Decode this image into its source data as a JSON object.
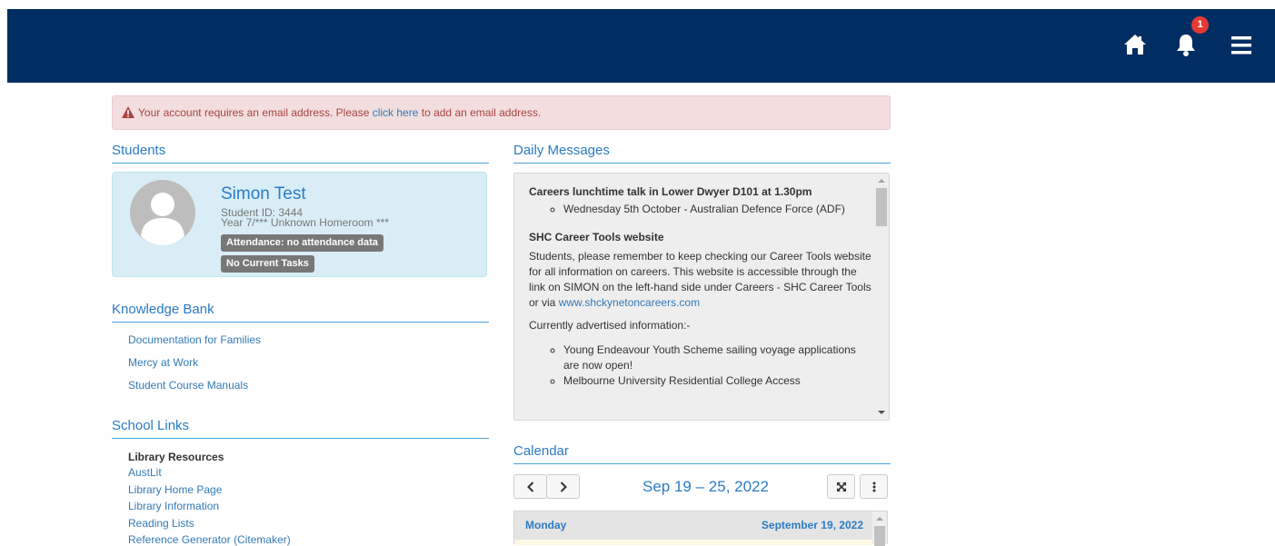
{
  "header": {
    "notification_count": "1",
    "colors": {
      "bar": "#002d62",
      "badge": "#e53935"
    },
    "icons": [
      "home-icon",
      "bell-icon",
      "menu-icon"
    ]
  },
  "alert": {
    "text_before": "Your account requires an email address. Please ",
    "link": "click here",
    "text_after": " to add an email address."
  },
  "students": {
    "title": "Students",
    "name": "Simon Test",
    "student_id": "Student ID: 3444",
    "homeroom": "Year 7/*** Unknown Homeroom ***",
    "attendance": "Attendance: no attendance data",
    "tasks": "No Current Tasks"
  },
  "knowledge_bank": {
    "title": "Knowledge Bank",
    "links": [
      "Documentation for Families",
      "Mercy at Work",
      "Student Course Manuals"
    ]
  },
  "school_links": {
    "title": "School Links",
    "group": "Library Resources",
    "links": [
      "AustLit",
      "Library Home Page",
      "Library Information",
      "Reading Lists",
      "Reference Generator (Citemaker)"
    ]
  },
  "daily_messages": {
    "title": "Daily Messages",
    "item1_title": "Careers lunchtime talk in Lower Dwyer D101 at 1.30pm",
    "item1_bullet": "Wednesday 5th October - Australian Defence Force (ADF)",
    "item2_title": "SHC Career Tools website",
    "item2_body": "Students, please remember to keep checking our Career Tools website for all information on careers. This website is accessible through the link on SIMON on the left-hand side under Careers - SHC Career Tools or via ",
    "item2_link": "www.shckynetoncareers.com",
    "item2_intro": "Currently advertised information:-",
    "item2_bullets": [
      "Young Endeavour Youth Scheme sailing voyage applications are now open!",
      "Melbourne University Residential College Access"
    ]
  },
  "calendar": {
    "title": "Calendar",
    "range": "Sep 19 – 25, 2022",
    "prev": "‹",
    "next": "›",
    "day": "Monday",
    "date": "September 19, 2022"
  }
}
